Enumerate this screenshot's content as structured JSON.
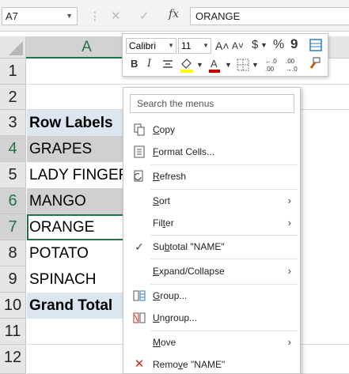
{
  "formula_bar": {
    "name_box": "A7",
    "cancel_glyph": "✕",
    "enter_glyph": "✓",
    "fx_label": "fx",
    "formula_value": "ORANGE"
  },
  "columns": {
    "a": "A"
  },
  "rows": [
    {
      "num": "1",
      "value": ""
    },
    {
      "num": "2",
      "value": ""
    },
    {
      "num": "3",
      "value": "Row Labels"
    },
    {
      "num": "4",
      "value": "GRAPES"
    },
    {
      "num": "5",
      "value": "LADY FINGER"
    },
    {
      "num": "6",
      "value": "MANGO"
    },
    {
      "num": "7",
      "value": "ORANGE"
    },
    {
      "num": "8",
      "value": "POTATO"
    },
    {
      "num": "9",
      "value": "SPINACH"
    },
    {
      "num": "10",
      "value": "Grand Total"
    },
    {
      "num": "11",
      "value": ""
    },
    {
      "num": "12",
      "value": ""
    }
  ],
  "mini_toolbar": {
    "font_name": "Calibri",
    "font_size": "11",
    "increase_font": "A˄",
    "decrease_font": "A˅",
    "currency": "$",
    "percent": "%",
    "comma": "9",
    "bold": "B",
    "italic": "I",
    "dec_increase": "←.0 .00",
    "dec_decrease": ".00 →.0"
  },
  "context_menu": {
    "search_placeholder": "Search the menus",
    "items": {
      "copy": {
        "pre": "",
        "key": "C",
        "post": "opy"
      },
      "format_cells": {
        "pre": "",
        "key": "F",
        "post": "ormat Cells..."
      },
      "refresh": {
        "pre": "",
        "key": "R",
        "post": "efresh"
      },
      "sort": {
        "pre": "",
        "key": "S",
        "post": "ort"
      },
      "filter": {
        "pre": "Fil",
        "key": "t",
        "post": "er"
      },
      "subtotal": {
        "pre": "Su",
        "key": "b",
        "post": "total \"NAME\""
      },
      "expand_collapse": {
        "pre": "",
        "key": "E",
        "post": "xpand/Collapse"
      },
      "group": {
        "pre": "",
        "key": "G",
        "post": "roup..."
      },
      "ungroup": {
        "pre": "",
        "key": "U",
        "post": "ngroup..."
      },
      "move": {
        "pre": "",
        "key": "M",
        "post": "ove"
      },
      "remove": {
        "pre": "Remo",
        "key": "v",
        "post": "e \"NAME\""
      }
    }
  },
  "colors": {
    "excel_green": "#217346",
    "row_label_bg": "#dce6f1",
    "selected_row_bg": "#d0d0d0",
    "remove_icon": "#c42b1c",
    "font_color": "#c00000",
    "highlight_color": "#ffff00"
  }
}
